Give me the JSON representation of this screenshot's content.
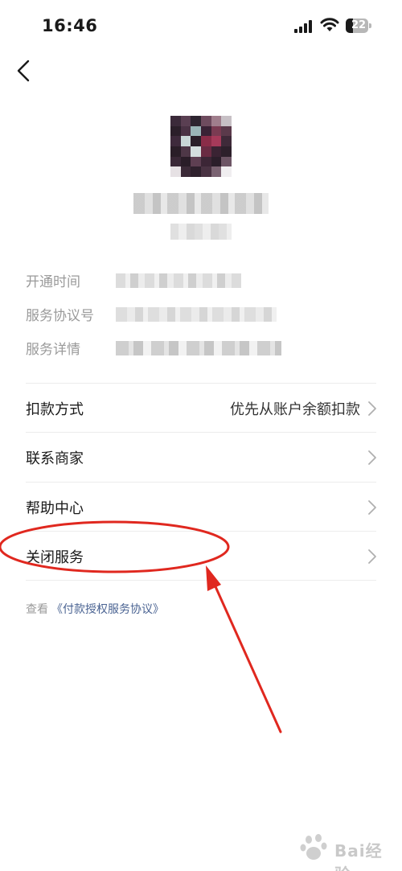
{
  "status_bar": {
    "time": "16:46",
    "battery_level": "22",
    "icons": [
      "signal-icon",
      "wifi-icon",
      "battery-icon"
    ]
  },
  "nav": {
    "back_icon": "chevron-left-icon"
  },
  "merchant": {
    "logo": "pixelated-merchant-logo",
    "name": "",
    "subtitle": ""
  },
  "info": {
    "rows": [
      {
        "label": "开通时间"
      },
      {
        "label": "服务协议号"
      },
      {
        "label": "服务详情"
      }
    ]
  },
  "menu": {
    "items": [
      {
        "label": "扣款方式",
        "value": "优先从账户余额扣款"
      },
      {
        "label": "联系商家",
        "value": ""
      },
      {
        "label": "帮助中心",
        "value": ""
      },
      {
        "label": "关闭服务",
        "value": ""
      }
    ]
  },
  "agreement": {
    "prefix": "查看",
    "link": "《付款授权服务协议》"
  },
  "annotation": {
    "color": "#e0281f",
    "highlight": "关闭服务"
  },
  "watermark": {
    "text": "Bai经验"
  },
  "colors": {
    "label_gray": "#9a9a9a",
    "link_blue": "#4a6392",
    "divider": "#ececec",
    "annotation_red": "#e0281f"
  }
}
